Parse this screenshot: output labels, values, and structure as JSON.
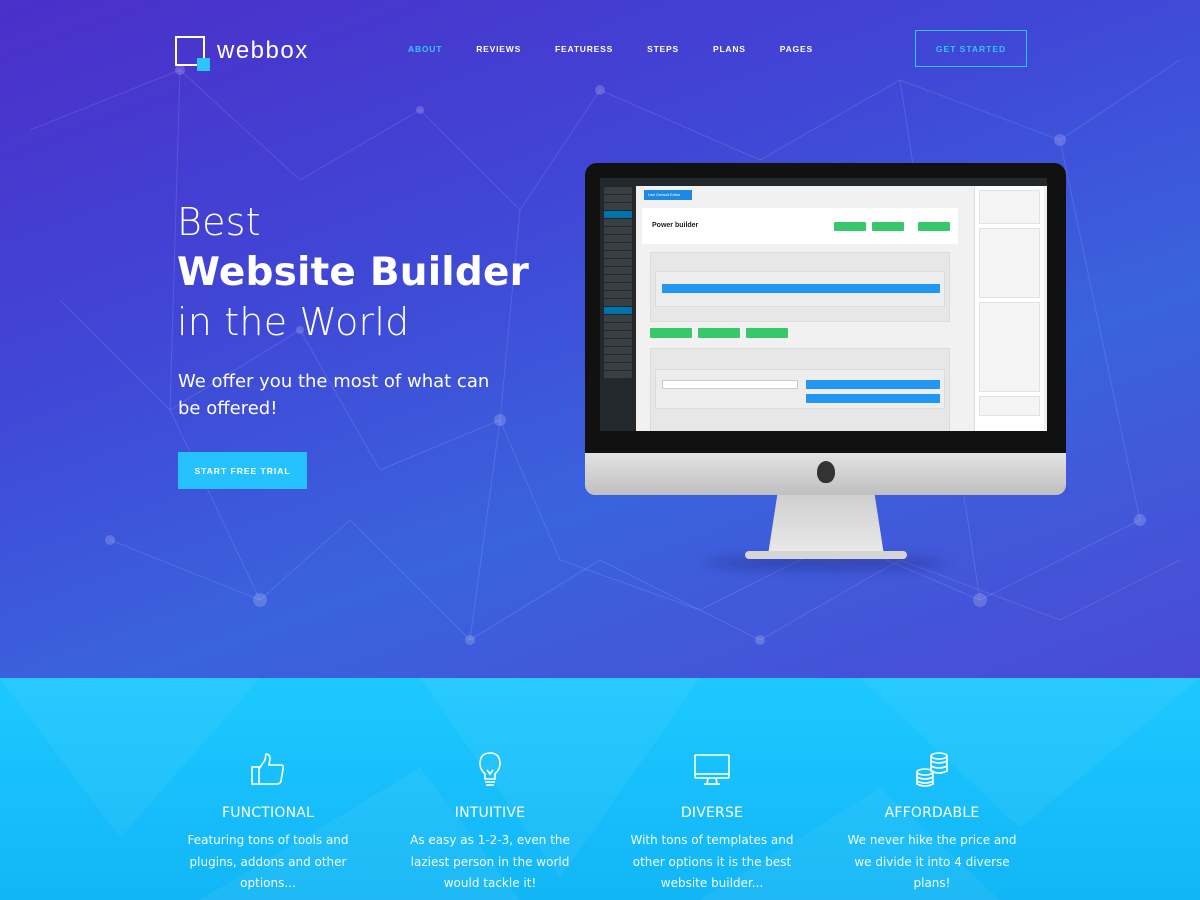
{
  "logo": {
    "text": "webbox"
  },
  "nav": {
    "items": [
      "ABOUT",
      "REVIEWS",
      "FEATURESS",
      "STEPS",
      "PLANS",
      "PAGES"
    ],
    "active_index": 0
  },
  "header": {
    "cta_label": "GET STARTED"
  },
  "hero": {
    "line1": "Best",
    "line2": "Website Builder",
    "line3": "in the World",
    "subtitle": "We offer you the most of what can be offered!",
    "cta_label": "START FREE TRIAL"
  },
  "screen": {
    "use_default_editor": "Use Default Editor",
    "builder_title": "Power builder"
  },
  "features": [
    {
      "icon": "thumbs-up-icon",
      "title": "FUNCTIONAL",
      "desc": "Featuring tons of tools and plugins, addons and other options..."
    },
    {
      "icon": "lightbulb-icon",
      "title": "INTUITIVE",
      "desc": "As easy as 1-2-3, even the laziest person in the world would tackle it!"
    },
    {
      "icon": "monitor-icon",
      "title": "DIVERSE",
      "desc": "With tons of templates and other options it is the best website builder..."
    },
    {
      "icon": "coins-icon",
      "title": "AFFORDABLE",
      "desc": "We never hike the price and we divide it into 4 diverse plans!"
    }
  ],
  "colors": {
    "accent": "#2ec5ff",
    "hero_start": "#4b2fc9",
    "hero_end": "#3a63de",
    "features_bg": "#1dc8ff"
  }
}
